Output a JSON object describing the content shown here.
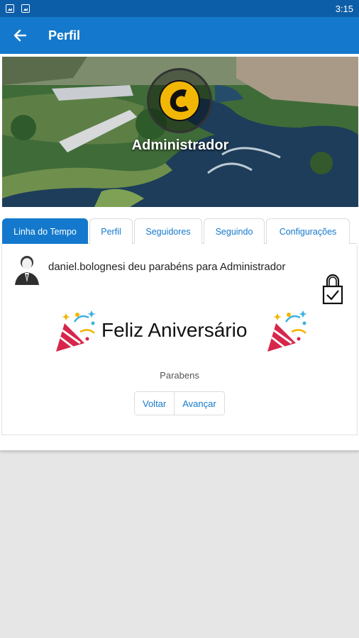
{
  "status_bar": {
    "time": "3:15",
    "icons": [
      "image-notification-icon",
      "photo-notification-icon"
    ]
  },
  "app_bar": {
    "title": "Perfil",
    "back_icon": "arrow-back-icon"
  },
  "profile": {
    "name": "Administrador",
    "logo_icon": "brand-logo-icon"
  },
  "tabs": [
    {
      "label": "Linha do Tempo",
      "active": true
    },
    {
      "label": "Perfil",
      "active": false
    },
    {
      "label": "Seguidores",
      "active": false
    },
    {
      "label": "Seguindo",
      "active": false
    },
    {
      "label": "Configurações",
      "active": false
    }
  ],
  "post": {
    "text": "daniel.bolognesi deu parabéns para Administrador",
    "heading": "Feliz Aniversário",
    "message": "Parabens",
    "lock_icon": "lock-check-icon",
    "party_icon": "party-popper-icon",
    "pager": {
      "prev_label": "Voltar",
      "next_label": "Avançar"
    }
  },
  "colors": {
    "status_bar": "#0d5ea8",
    "app_bar": "#1479cc",
    "accent": "#1479cc",
    "background": "#e6e6e6"
  }
}
